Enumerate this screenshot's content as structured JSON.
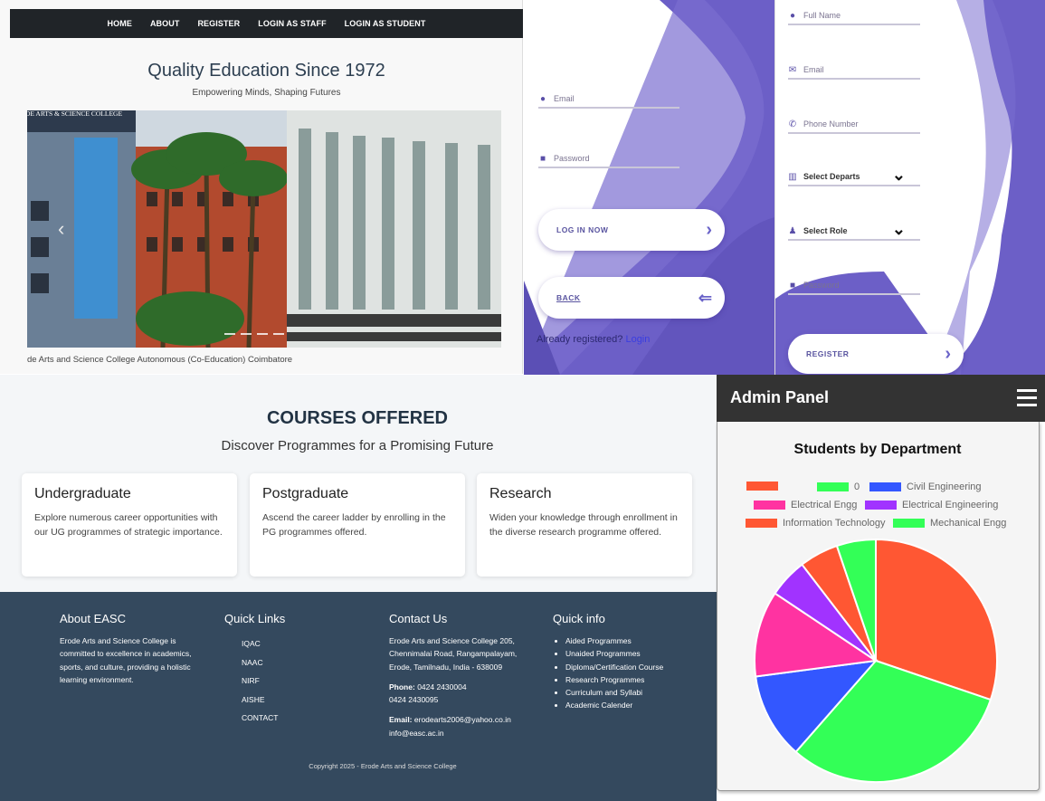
{
  "site": {
    "nav": [
      "HOME",
      "ABOUT",
      "REGISTER",
      "LOGIN AS STAFF",
      "LOGIN AS STUDENT"
    ],
    "hero_title": "Quality Education Since 1972",
    "hero_subtitle": "Empowering Minds, Shaping Futures",
    "carousel_sign": "ERODE ARTS & SCIENCE COLLEGE",
    "caption": "de Arts and Science College Autonomous (Co-Education) Coimbatore"
  },
  "login": {
    "email_placeholder": "Email",
    "password_placeholder": "Password",
    "login_button": "LOG IN NOW",
    "back_button": "BACK",
    "already_text": "Already registered?",
    "login_link": "Login"
  },
  "register": {
    "full_name_placeholder": "Full Name",
    "email_placeholder": "Email",
    "phone_placeholder": "Phone Number",
    "department_select": "Select Departs",
    "role_select": "Select Role",
    "password_placeholder": "Password",
    "register_button": "REGISTER"
  },
  "courses": {
    "title": "COURSES OFFERED",
    "subtitle": "Discover Programmes for a Promising Future",
    "cards": [
      {
        "title": "Undergraduate",
        "text": "Explore numerous career opportunities with our UG programmes of strategic importance."
      },
      {
        "title": "Postgraduate",
        "text": "Ascend the career ladder by enrolling in the PG programmes offered."
      },
      {
        "title": "Research",
        "text": "Widen your knowledge through enrollment in the diverse research programme offered."
      }
    ]
  },
  "footer": {
    "about_title": "About EASC",
    "about_text": "Erode Arts and Science College is committed to excellence in academics, sports, and culture, providing a holistic learning environment.",
    "quick_links_title": "Quick Links",
    "quick_links": [
      "IQAC",
      "NAAC",
      "NIRF",
      "AISHE",
      "CONTACT"
    ],
    "contact_title": "Contact Us",
    "contact_address": "Erode Arts and Science College 205, Chennimalai Road, Rangampalayam, Erode, Tamilnadu, India - 638009",
    "phone_label": "Phone:",
    "phone_1": "0424 2430004",
    "phone_2": "0424 2430095",
    "email_label": "Email:",
    "email_1": "erodearts2006@yahoo.co.in",
    "email_2": "info@easc.ac.in",
    "quick_info_title": "Quick info",
    "quick_info": [
      "Aided Programmes",
      "Unaided Programmes",
      "Diploma/Certification Course",
      "Research Programmes",
      "Curriculum and Syllabi",
      "Academic Calender"
    ],
    "copyright": "Copyright 2025 - Erode Arts and Science College"
  },
  "admin": {
    "title": "Admin Panel",
    "menu_icon": "hamburger-icon"
  },
  "chart_data": {
    "type": "pie",
    "title": "Students by Department",
    "legend_position": "top",
    "categories": [
      "",
      "0",
      "Civil Engineering",
      "Electrical Engg",
      "Electrical Engineering",
      "Information Technology",
      "Mechanical Engg"
    ],
    "values": [
      29,
      30,
      11,
      11,
      5,
      5,
      5
    ],
    "colors": [
      "#ff5733",
      "#33ff57",
      "#3357ff",
      "#ff33a1",
      "#a133ff",
      "#ff5733",
      "#33ff57"
    ]
  }
}
